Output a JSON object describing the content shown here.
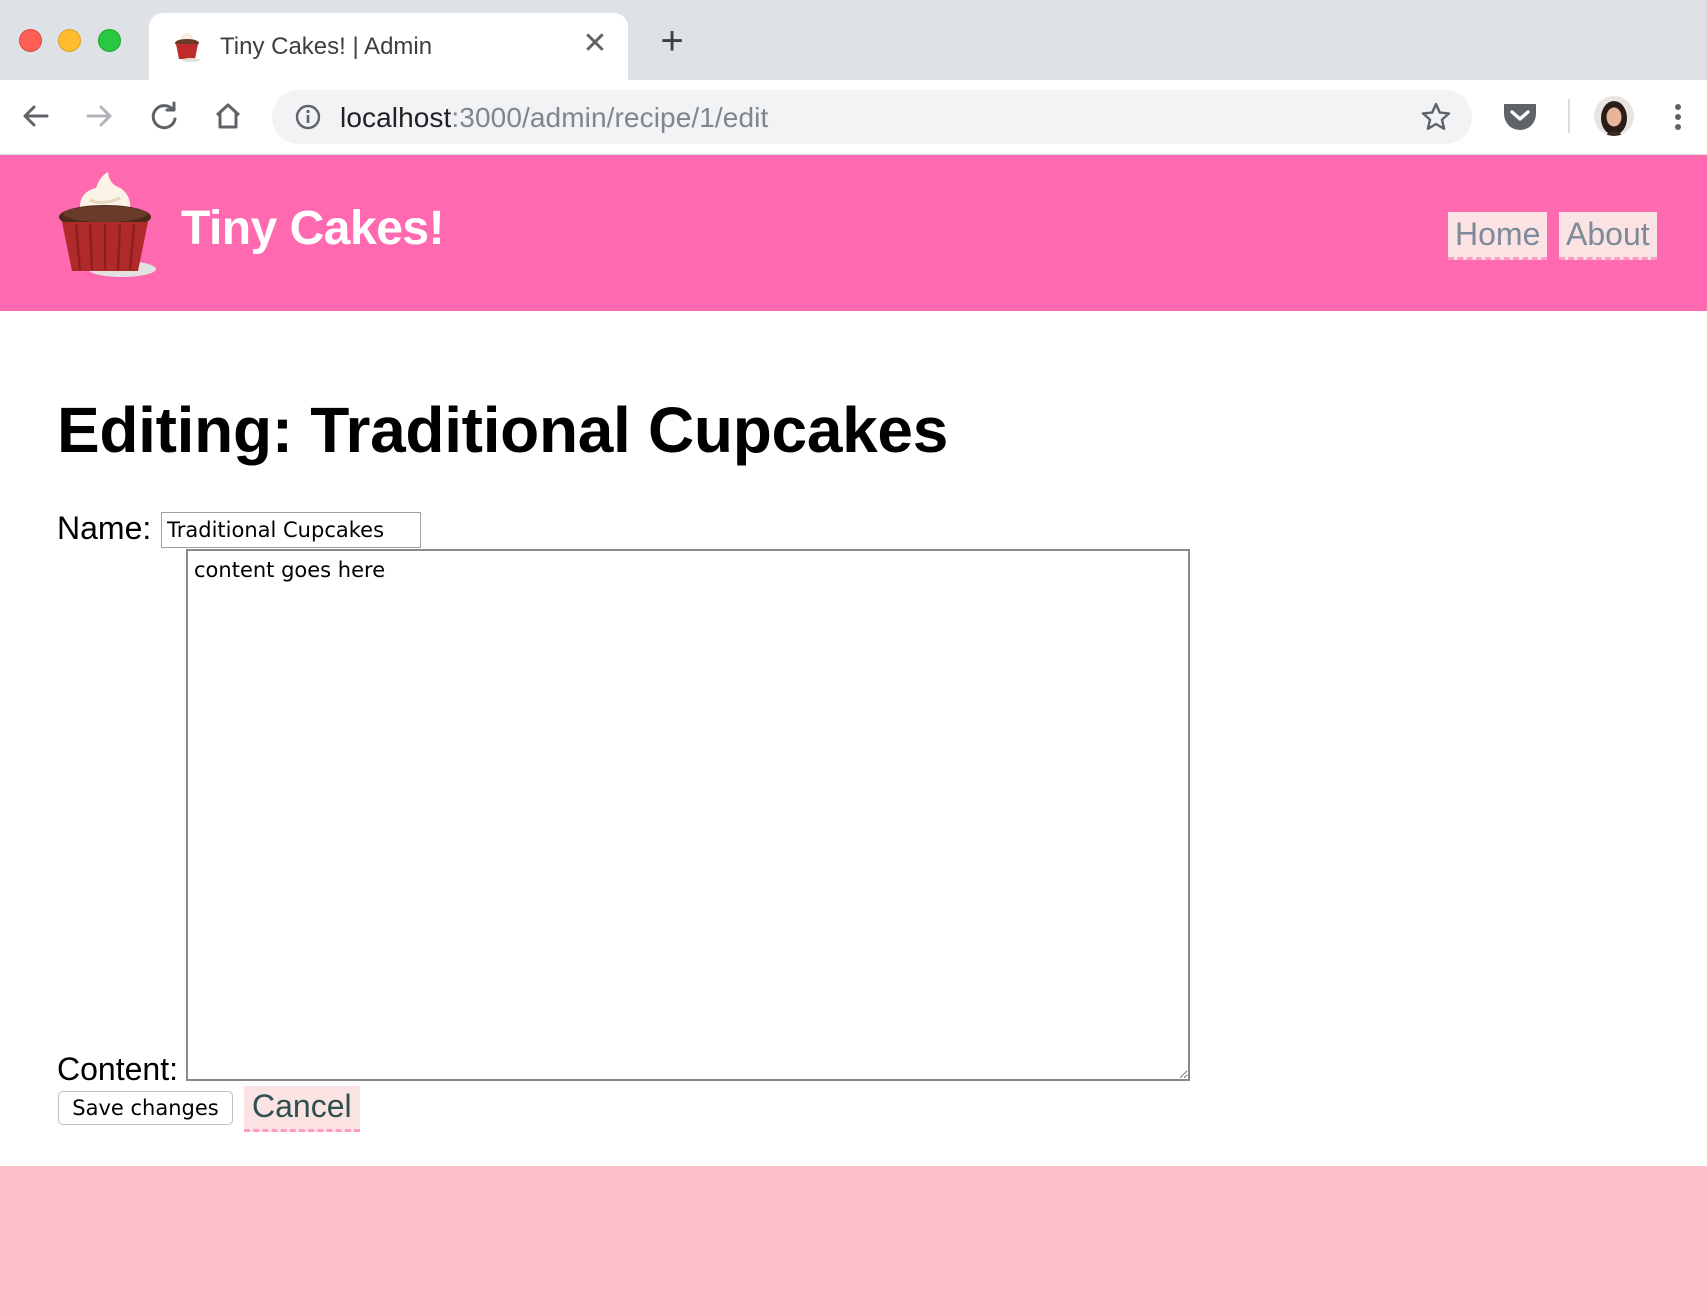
{
  "browser": {
    "tab_title": "Tiny Cakes! | Admin",
    "tab_close_glyph": "✕",
    "new_tab_glyph": "+",
    "url_host": "localhost",
    "url_rest": ":3000/admin/recipe/1/edit"
  },
  "site": {
    "title": "Tiny Cakes!",
    "brand_color": "#ff69b0",
    "footer_color": "#ffc0cb",
    "nav": {
      "home": "Home",
      "about": "About"
    }
  },
  "main": {
    "heading": "Editing: Traditional Cupcakes",
    "form": {
      "name_label": "Name:",
      "name_value": "Traditional Cupcakes",
      "content_label": "Content:",
      "content_value": "content goes here",
      "save_label": "Save changes",
      "cancel_label": "Cancel"
    }
  },
  "icons": [
    "cupcake-favicon",
    "back-icon",
    "forward-icon",
    "reload-icon",
    "home-icon",
    "info-icon",
    "star-icon",
    "pocket-icon",
    "avatar",
    "kebab-menu-icon",
    "cupcake-logo"
  ]
}
